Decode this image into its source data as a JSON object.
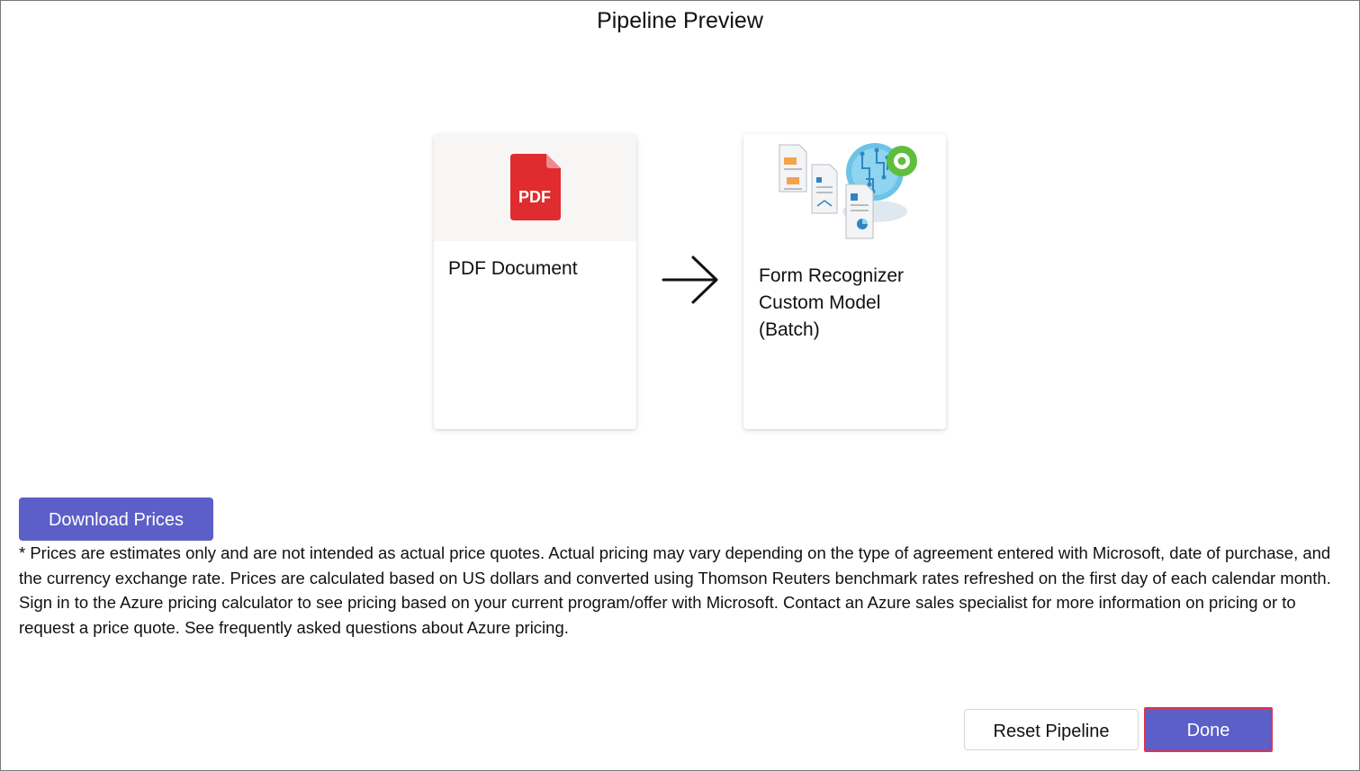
{
  "dialog": {
    "title": "Pipeline Preview"
  },
  "pipeline": {
    "steps": [
      {
        "label": "PDF Document",
        "icon": "pdf-file-icon",
        "icon_text": "PDF"
      },
      {
        "label": "Form Recognizer Custom Model (Batch)",
        "icon": "form-recognizer-icon"
      }
    ],
    "connector_icon": "arrow-right-icon"
  },
  "pricing": {
    "download_label": "Download Prices",
    "disclaimer": "* Prices are estimates only and are not intended as actual price quotes. Actual pricing may vary depending on the type of agreement entered with Microsoft, date of purchase, and the currency exchange rate. Prices are calculated based on US dollars and converted using Thomson Reuters benchmark rates refreshed on the first day of each calendar month. Sign in to the Azure pricing calculator to see pricing based on your current program/offer with Microsoft. Contact an Azure sales specialist for more information on pricing or to request a price quote. See frequently asked questions about Azure pricing."
  },
  "footer": {
    "reset_label": "Reset Pipeline",
    "done_label": "Done"
  },
  "colors": {
    "primary": "#5b5fc7",
    "pdf_red": "#e02b2f",
    "highlight_border": "#e0334d",
    "gear_green": "#5fbf3c"
  }
}
